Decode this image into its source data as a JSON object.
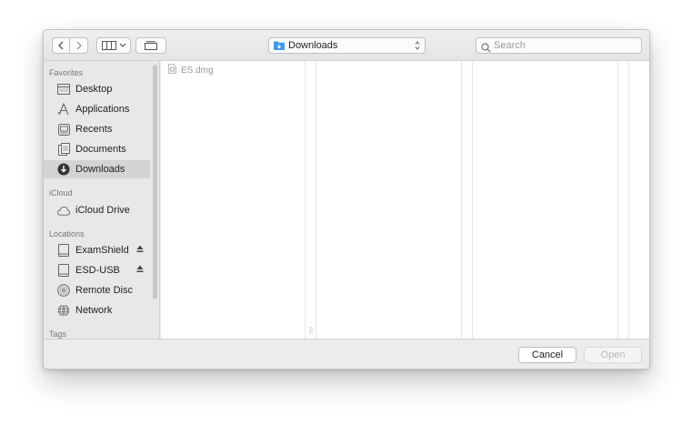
{
  "toolbar": {
    "location_label": "Downloads",
    "search_placeholder": "Search"
  },
  "sidebar": {
    "favorites_header": "Favorites",
    "favorites": [
      {
        "label": "Desktop",
        "icon": "desktop-icon"
      },
      {
        "label": "Applications",
        "icon": "applications-icon"
      },
      {
        "label": "Recents",
        "icon": "recents-icon"
      },
      {
        "label": "Documents",
        "icon": "documents-icon"
      },
      {
        "label": "Downloads",
        "icon": "downloads-icon",
        "selected": true
      }
    ],
    "icloud_header": "iCloud",
    "icloud": [
      {
        "label": "iCloud Drive",
        "icon": "cloud-icon"
      }
    ],
    "locations_header": "Locations",
    "locations": [
      {
        "label": "ExamShield",
        "icon": "drive-icon",
        "eject": true
      },
      {
        "label": "ESD-USB",
        "icon": "drive-icon",
        "eject": true
      },
      {
        "label": "Remote Disc",
        "icon": "disc-icon"
      },
      {
        "label": "Network",
        "icon": "network-icon"
      }
    ],
    "tags_header": "Tags"
  },
  "browser": {
    "files": [
      {
        "name": "ES.dmg",
        "icon": "dmg-file-icon"
      }
    ]
  },
  "footer": {
    "cancel_label": "Cancel",
    "open_label": "Open"
  },
  "colors": {
    "window_bg": "#ececec",
    "sidebar_bg": "#e8e8e8",
    "selected_bg": "#d3d3d3",
    "folder_blue": "#3d9ae8"
  }
}
